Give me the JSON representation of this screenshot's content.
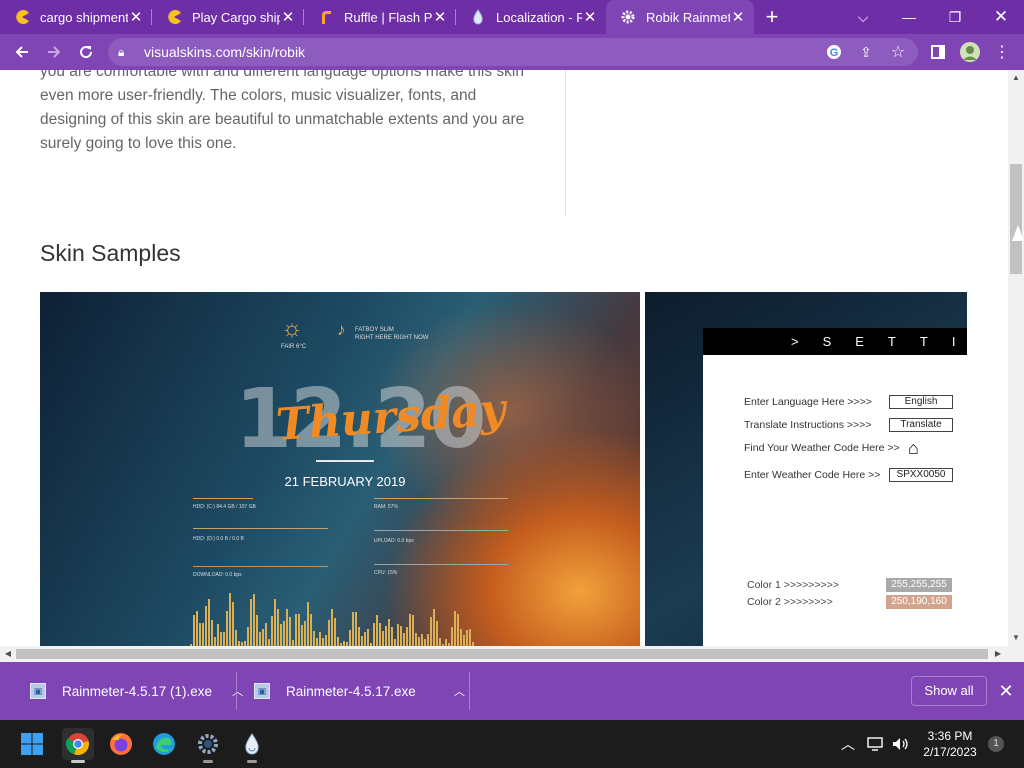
{
  "browser": {
    "tabs": [
      {
        "title": "cargo shipment",
        "icon": "pacman-icon",
        "active": false
      },
      {
        "title": "Play Cargo ship",
        "icon": "pacman-icon",
        "active": false
      },
      {
        "title": "Ruffle | Flash Pla",
        "icon": "ruffle-icon",
        "active": false
      },
      {
        "title": "Localization - Ra",
        "icon": "rainmeter-drop-icon",
        "active": false
      },
      {
        "title": "Robik Rainmete",
        "icon": "gear-icon",
        "active": true
      }
    ],
    "url": "visualskins.com/skin/robik"
  },
  "article": {
    "paragraph": "you are comfortable with and different language options make this skin even more user-friendly. The colors, music visualizer, fonts, and designing of this skin are beautiful to unmatchable extents and you are surely going to love this one.",
    "section_title": "Skin Samples"
  },
  "sample1": {
    "weather": "FAIR 6°C",
    "song_line1": "FATBOY SLIM",
    "song_line2": "RIGHT HERE RIGHT NOW",
    "time": "12.20",
    "day": "Thursday",
    "date": "21 FEBRUARY 2019",
    "hdd1": "HDD: (C:) 84.4 GB / 107 GB",
    "hdd2": "HDD: (D:) 0.0 B / 0.0 B",
    "download": "DOWNLOAD: 0.0 bps",
    "ram": "RAM: 57%",
    "upload": "UPLOAD: 0.0 bps",
    "cpu": "CPU: 15%"
  },
  "sample2": {
    "header": ">SETTI",
    "rows": [
      {
        "label": "Enter Language Here  >>>>",
        "value": "English"
      },
      {
        "label": "Translate Instructions  >>>>",
        "value": "Translate"
      },
      {
        "label": "Find Your Weather Code Here >>",
        "value": ""
      },
      {
        "label": "Enter Weather Code Here >>",
        "value": "SPXX0050"
      }
    ],
    "color1_label": "Color 1  >>>>>>>>>",
    "color1_value": "255,255,255",
    "color2_label": "Color 2  >>>>>>>>",
    "color2_value": "250,190,160",
    "color1_swatch": "#a9a9a9",
    "color2_swatch": "#d2a48e"
  },
  "downloads": {
    "items": [
      {
        "name": "Rainmeter-4.5.17 (1).exe"
      },
      {
        "name": "Rainmeter-4.5.17.exe"
      }
    ],
    "show_all": "Show all"
  },
  "taskbar": {
    "time": "3:36 PM",
    "date": "2/17/2023",
    "notifications": "1"
  },
  "colors": {
    "chrome_frame": "#6e2ea6",
    "chrome_toolbar": "#7f45b4",
    "taskbar": "#1c1c1c"
  }
}
